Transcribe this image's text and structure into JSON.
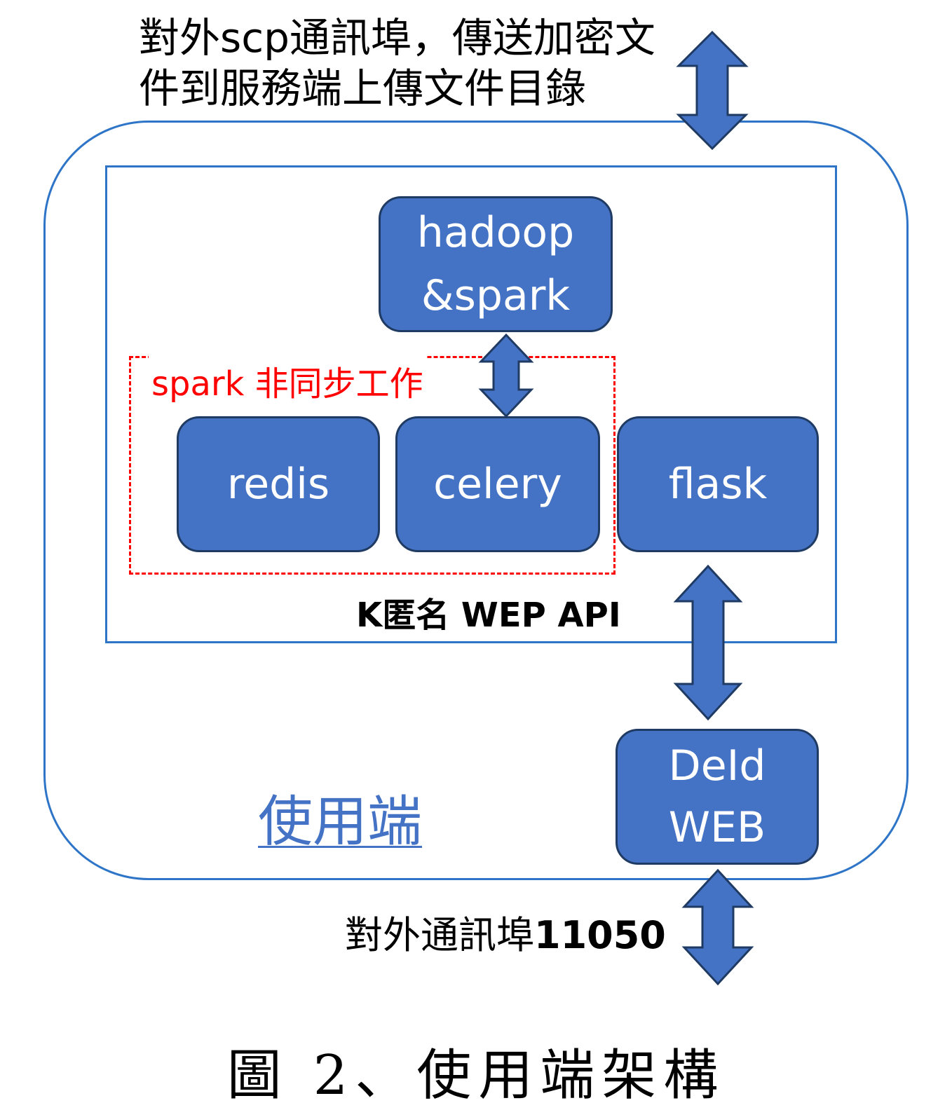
{
  "annotations": {
    "scp_port_line1": "對外scp通訊埠，傳送加密文",
    "scp_port_line2": "件到服務端上傳文件目錄",
    "async_group_label": "spark 非同步工作",
    "api_label": "K匿名 WEP API",
    "client_label": "使用端",
    "external_port_prefix": "對外通訊埠",
    "external_port_number": "11050"
  },
  "nodes": {
    "hadoop_spark": {
      "line1": "hadoop",
      "line2": "&spark"
    },
    "redis": {
      "label": "redis"
    },
    "celery": {
      "label": "celery"
    },
    "flask": {
      "label": "flask"
    },
    "deid_web": {
      "line1": "DeId",
      "line2": "WEB"
    }
  },
  "caption": "圖 2、使用端架構",
  "colors": {
    "node_fill": "#4472c4",
    "node_border": "#1f3b63",
    "container_border": "#2e75c8",
    "async_group_border": "#ff0000",
    "client_label": "#4472c4"
  }
}
